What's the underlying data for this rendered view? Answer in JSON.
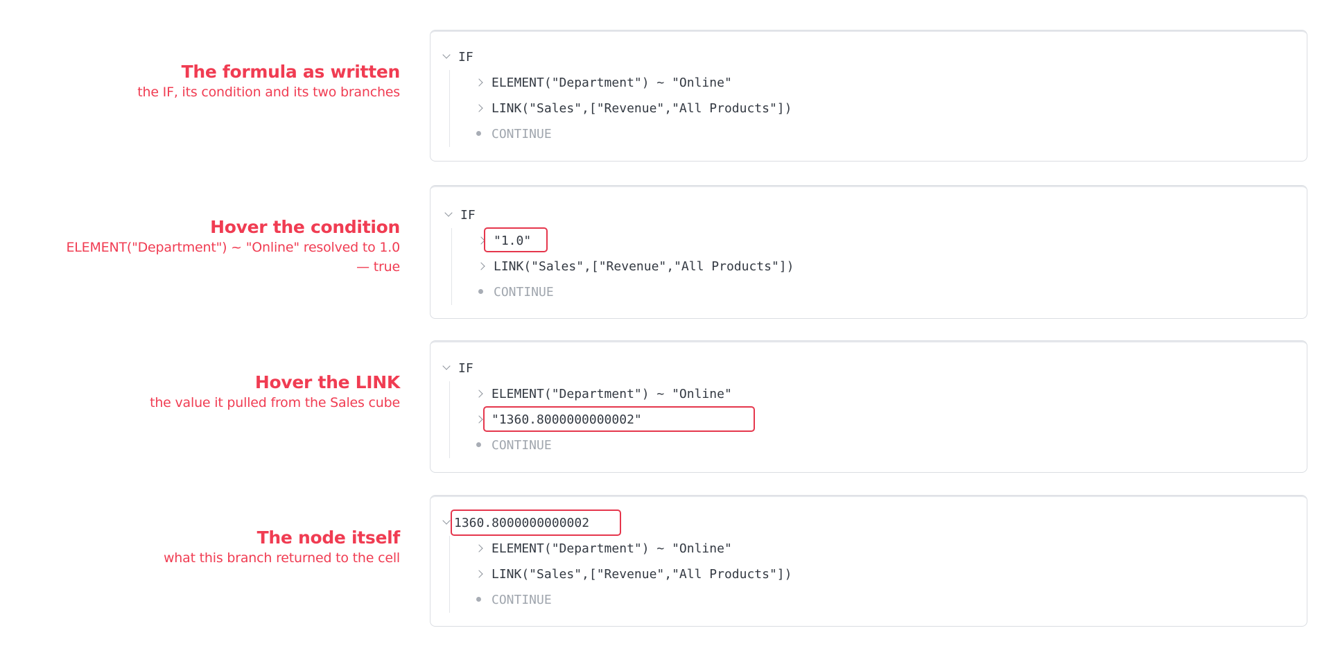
{
  "panels": [
    {
      "title": "The formula as written",
      "subtitle": "the IF, its condition and its two branches",
      "root": "IF",
      "condition": "ELEMENT(\"Department\") ~ \"Online\"",
      "link": "LINK(\"Sales\",[\"Revenue\",\"All Products\"])",
      "continue": "CONTINUE"
    },
    {
      "title": "Hover the condition",
      "subtitle_line1": "ELEMENT(\"Department\") ~ \"Online\" resolved to 1.0",
      "subtitle_line2": "— true",
      "root": "IF",
      "condition": "\"1.0\"",
      "link": "LINK(\"Sales\",[\"Revenue\",\"All Products\"])",
      "continue": "CONTINUE"
    },
    {
      "title": "Hover the LINK",
      "subtitle": "the value it pulled from the Sales cube",
      "root": "IF",
      "condition": "ELEMENT(\"Department\") ~ \"Online\"",
      "link": "\"1360.8000000000002\"",
      "continue": "CONTINUE"
    },
    {
      "title": "The node itself",
      "subtitle": "what this branch returned to the cell",
      "root": "1360.8000000000002",
      "condition": "ELEMENT(\"Department\") ~ \"Online\"",
      "link": "LINK(\"Sales\",[\"Revenue\",\"All Products\"])",
      "continue": "CONTINUE"
    }
  ],
  "colors": {
    "accent": "#f03c52",
    "highlight_border": "#e5364c",
    "panel_border": "#dadde2",
    "code_text": "#333942",
    "muted_text": "#a0a6ae"
  },
  "icons": {
    "expanded": "chevron-down-icon",
    "collapsed": "chevron-right-icon",
    "leaf": "bullet-icon"
  }
}
